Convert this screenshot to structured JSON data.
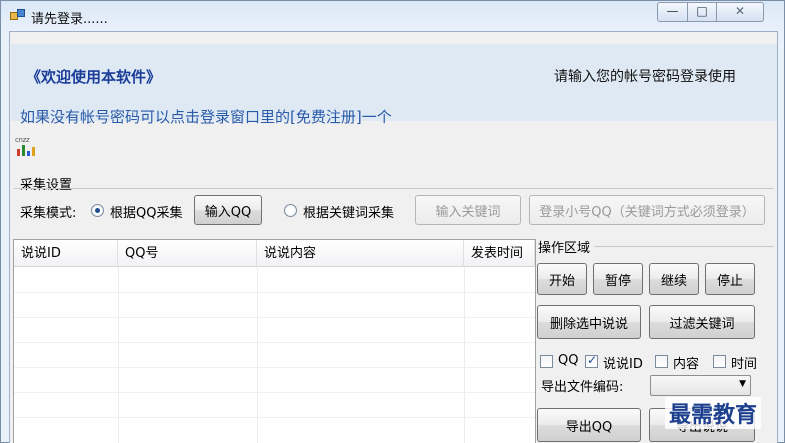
{
  "window": {
    "title": "请先登录......",
    "min_glyph": "—",
    "max_glyph": "□",
    "close_glyph": "✕"
  },
  "banner": {
    "welcome": "《欢迎使用本软件》",
    "login_hint": "请输入您的帐号密码登录使用",
    "register_hint": "如果没有帐号密码可以点击登录窗口里的[免费注册]一个",
    "stat_icon_text": "cnzz"
  },
  "collect": {
    "title": "采集设置",
    "mode_label": "采集模式:",
    "by_qq_label": "根据QQ采集",
    "input_qq_btn": "输入QQ",
    "by_keyword_label": "根据关键词采集",
    "input_keyword_btn": "输入关键词",
    "login_small_btn": "登录小号QQ（关键词方式必须登录）"
  },
  "table": {
    "columns": [
      "说说ID",
      "QQ号",
      "说说内容",
      "发表时间"
    ]
  },
  "ops": {
    "title": "操作区域",
    "start": "开始",
    "pause": "暂停",
    "resume": "继续",
    "stop": "停止",
    "delete_selected": "删除选中说说",
    "filter_keywords": "过滤关键词",
    "chk_qq": "QQ",
    "chk_id": "说说ID",
    "chk_content": "内容",
    "chk_time": "时间",
    "encoding_label": "导出文件编码:",
    "export_qq": "导出QQ",
    "export_other": "导出说说"
  },
  "watermark": "最需教育",
  "colors": {
    "accent": "#1a3d99",
    "hint": "#2a5aa8",
    "banner_bg": "#dfe9f4"
  }
}
